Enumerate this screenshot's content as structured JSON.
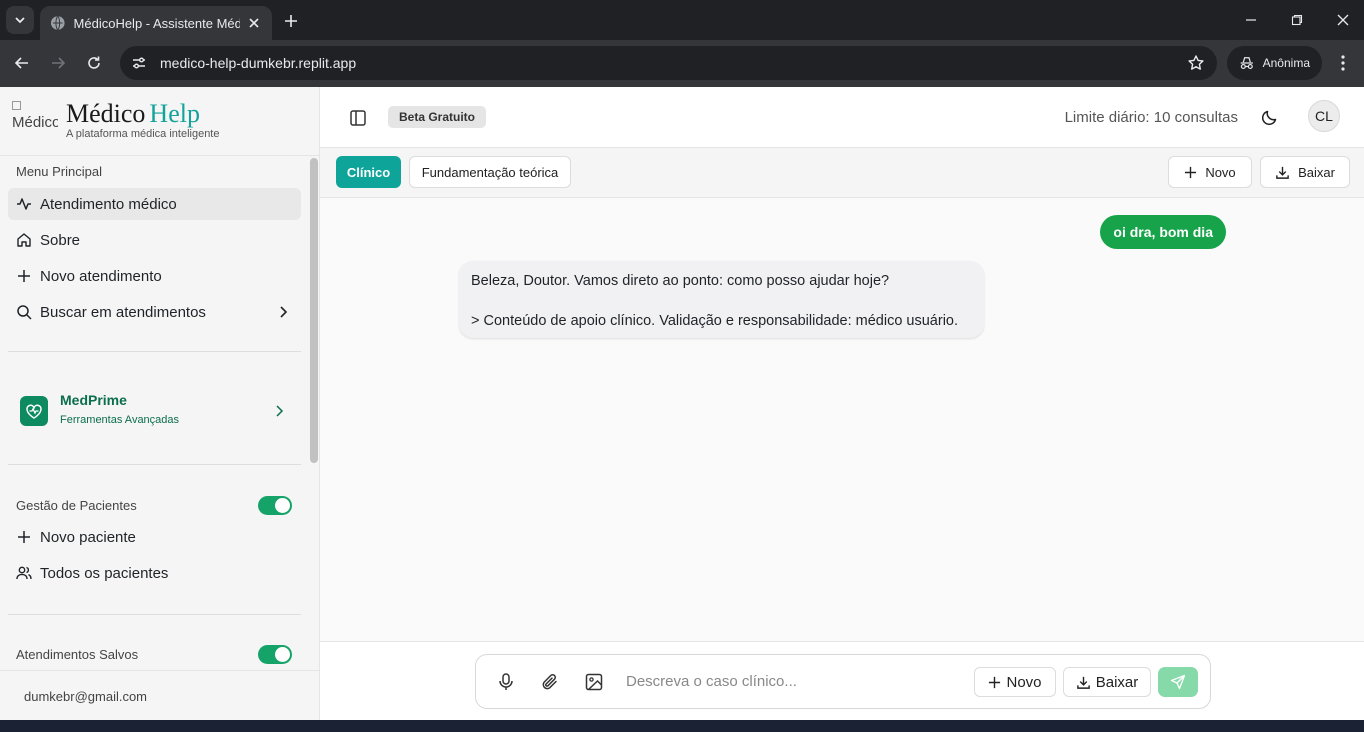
{
  "browser": {
    "tab_title": "MédicoHelp - Assistente Médico",
    "url": "medico-help-dumkebr.replit.app",
    "profile_label": "Anônima"
  },
  "brand": {
    "logo_alt": "Médico",
    "name_part1": "Médico",
    "name_part2": "Help",
    "tagline": "A plataforma médica inteligente"
  },
  "sidebar": {
    "menu_label": "Menu Principal",
    "menu_items": [
      {
        "label": "Atendimento médico",
        "icon": "activity-icon",
        "active": true
      },
      {
        "label": "Sobre",
        "icon": "home-icon"
      },
      {
        "label": "Novo atendimento",
        "icon": "plus-icon"
      },
      {
        "label": "Buscar em atendimentos",
        "icon": "search-icon"
      }
    ],
    "medprime": {
      "title": "MedPrime",
      "subtitle": "Ferramentas Avançadas"
    },
    "patients_label": "Gestão de Pacientes",
    "patients_enabled": true,
    "patient_items": [
      {
        "label": "Novo paciente",
        "icon": "plus-icon"
      },
      {
        "label": "Todos os pacientes",
        "icon": "users-icon"
      }
    ],
    "saved_label": "Atendimentos Salvos",
    "saved_enabled": true,
    "user_email": "dumkebr@gmail.com"
  },
  "header": {
    "badge": "Beta Gratuito",
    "limit_text": "Limite diário: 10 consultas",
    "avatar_initials": "CL"
  },
  "modes": {
    "clinical": "Clínico",
    "theory": "Fundamentação teórica",
    "new_label": "Novo",
    "download_label": "Baixar"
  },
  "chat": {
    "user_message": "oi dra, bom dia",
    "bot_line1": "Beleza, Doutor. Vamos direto ao ponto: como posso ajudar hoje?",
    "bot_line2": "> Conteúdo de apoio clínico. Validação e responsabilidade: médico usuário."
  },
  "composer": {
    "placeholder": "Descreva o caso clínico...",
    "new_label": "Novo",
    "download_label": "Baixar"
  },
  "colors": {
    "accent_teal": "#0fa49a",
    "user_bubble_green": "#16a34a",
    "toggle_green": "#16a36a",
    "medprime_green": "#0d8a5f"
  }
}
